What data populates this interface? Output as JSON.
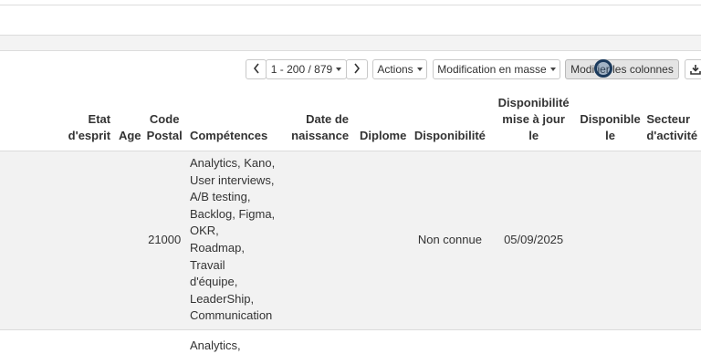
{
  "pagination": {
    "prev_icon": "chevron-left-icon",
    "range": "1 - 200 / 879",
    "next_icon": "chevron-right-icon"
  },
  "toolbar": {
    "actions_label": "Actions",
    "bulk_edit_label": "Modification en masse",
    "edit_columns_label": "Modifier les colonnes",
    "download_icon": "download-icon"
  },
  "table": {
    "headers": {
      "etat": [
        "Etat",
        "d'esprit"
      ],
      "age": "Age",
      "cp": [
        "Code",
        "Postal"
      ],
      "comp": "Compétences",
      "dob": [
        "Date de",
        "naissance"
      ],
      "diplome": "Diplome",
      "dispo": "Disponibilité",
      "maj": [
        "Disponibilité",
        "mise à jour",
        "le"
      ],
      "dispo_le": [
        "Disponible",
        "le"
      ],
      "secteur": [
        "Secteur",
        "d'activité"
      ]
    },
    "rows": [
      {
        "cp": "21000",
        "comp": [
          "Analytics, Kano,",
          "User interviews,",
          "A/B testing,",
          "Backlog, Figma,",
          "OKR,",
          "Roadmap,",
          "Travail",
          "d'équipe,",
          "LeaderShip,",
          "Communication"
        ],
        "dispo": "Non connue",
        "maj": "05/09/2025"
      },
      {
        "comp": [
          "Analytics,"
        ]
      }
    ]
  }
}
